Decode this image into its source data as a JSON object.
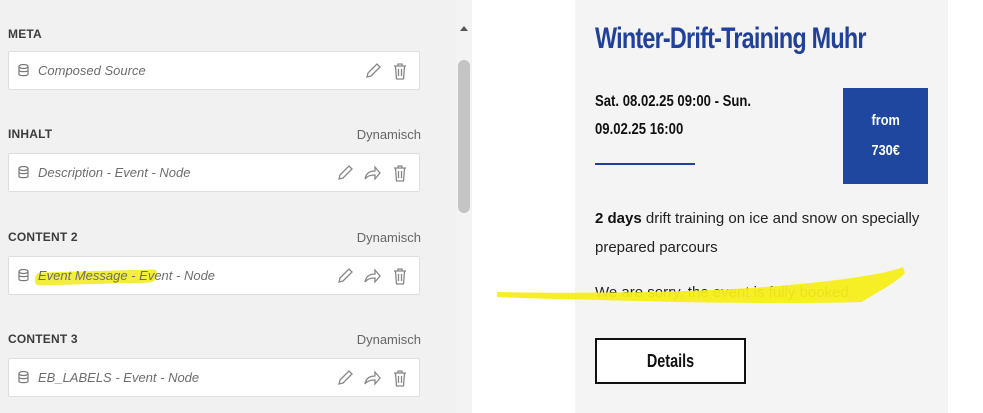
{
  "panel": {
    "sections": [
      {
        "label": "META",
        "dynamic": "",
        "field": "Composed Source",
        "actions": [
          "edit",
          "delete"
        ]
      },
      {
        "label": "INHALT",
        "dynamic": "Dynamisch",
        "field": "Description - Event - Node",
        "actions": [
          "edit",
          "link",
          "delete"
        ]
      },
      {
        "label": "CONTENT 2",
        "dynamic": "Dynamisch",
        "field": "Event Message - Event - Node",
        "actions": [
          "edit",
          "link",
          "delete"
        ]
      },
      {
        "label": "CONTENT 3",
        "dynamic": "Dynamisch",
        "field": "EB_LABELS - Event - Node",
        "actions": [
          "edit",
          "link",
          "delete"
        ]
      }
    ]
  },
  "preview": {
    "title": "Winter-Drift-Training Muhr",
    "dates_line1": "Sat. 08.02.25 09:00 - Sun.",
    "dates_line2": "09.02.25 16:00",
    "price_line1": "from",
    "price_line2": "730€",
    "desc_bold": "2 days",
    "desc_rest": " drift training on ice and snow on specially prepared parcours",
    "sorry": "We are sorry, the event is fully booked.",
    "details_button": "Details"
  },
  "colors": {
    "accent_blue": "#21409a",
    "price_box": "#1f47a0",
    "highlight_yellow": "#f5ee1a"
  },
  "icons": [
    "database-icon",
    "pencil-icon",
    "share-arrow-icon",
    "trash-icon"
  ]
}
